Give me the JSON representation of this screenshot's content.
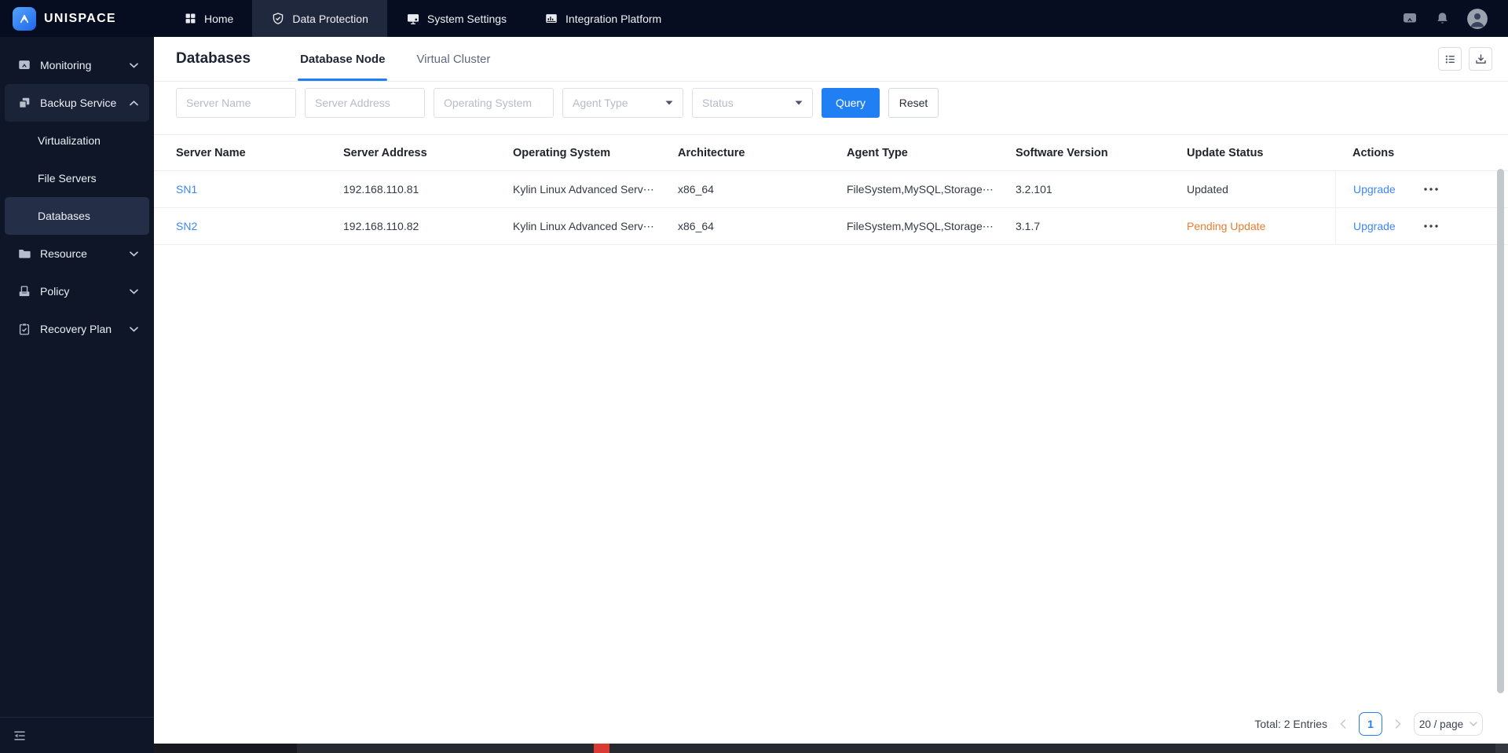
{
  "topbar": {
    "brand": "UNISPACE",
    "nav": [
      {
        "label": "Home",
        "icon": "home-icon",
        "active": false
      },
      {
        "label": "Data Protection",
        "icon": "shield-icon",
        "active": true
      },
      {
        "label": "System Settings",
        "icon": "display-icon",
        "active": false
      },
      {
        "label": "Integration Platform",
        "icon": "chart-window-icon",
        "active": false
      }
    ],
    "right_icons": [
      "message-icon",
      "bell-icon",
      "avatar"
    ]
  },
  "sidebar": {
    "items": [
      {
        "label": "Monitoring",
        "icon": "monitoring-icon",
        "state": "collapsed"
      },
      {
        "label": "Backup Service",
        "icon": "backup-icon",
        "state": "expanded",
        "children": [
          {
            "label": "Virtualization",
            "selected": false
          },
          {
            "label": "File Servers",
            "selected": false
          },
          {
            "label": "Databases",
            "selected": true
          }
        ]
      },
      {
        "label": "Resource",
        "icon": "folder-icon",
        "state": "collapsed"
      },
      {
        "label": "Policy",
        "icon": "policy-icon",
        "state": "collapsed"
      },
      {
        "label": "Recovery Plan",
        "icon": "clipboard-check-icon",
        "state": "collapsed"
      }
    ],
    "footer_icon": "collapse-sidebar-icon"
  },
  "page": {
    "title": "Databases",
    "tabs": [
      {
        "label": "Database Node",
        "active": true
      },
      {
        "label": "Virtual Cluster",
        "active": false
      }
    ],
    "toolbar_icons": [
      "list-icon",
      "download-icon"
    ],
    "filters": {
      "inputs": [
        {
          "placeholder": "Server Name",
          "value": ""
        },
        {
          "placeholder": "Server Address",
          "value": ""
        },
        {
          "placeholder": "Operating System",
          "value": ""
        }
      ],
      "selects": [
        {
          "placeholder": "Agent Type"
        },
        {
          "placeholder": "Status"
        }
      ],
      "query_label": "Query",
      "reset_label": "Reset"
    },
    "table": {
      "columns": [
        "Server Name",
        "Server Address",
        "Operating System",
        "Architecture",
        "Agent Type",
        "Software Version",
        "Update Status",
        "Actions"
      ],
      "rows": [
        {
          "server_name": "SN1",
          "server_address": "192.168.110.81",
          "operating_system": "Kylin Linux Advanced Serv⋯",
          "architecture": "x86_64",
          "agent_type": "FileSystem,MySQL,Storage⋯",
          "software_version": "3.2.101",
          "update_status": "Updated",
          "update_status_state": "updated",
          "action_upgrade": "Upgrade"
        },
        {
          "server_name": "SN2",
          "server_address": "192.168.110.82",
          "operating_system": "Kylin Linux Advanced Serv⋯",
          "architecture": "x86_64",
          "agent_type": "FileSystem,MySQL,Storage⋯",
          "software_version": "3.1.7",
          "update_status": "Pending Update",
          "update_status_state": "pending",
          "action_upgrade": "Upgrade"
        }
      ]
    },
    "pagination": {
      "total_label": "Total: 2 Entries",
      "current_page": "1",
      "page_size_label": "20 / page"
    }
  },
  "colors": {
    "accent": "#2080F3",
    "link": "#3D87F5",
    "pending_update": "#ED7B2F",
    "topbar_bg": "#070D21",
    "sidebar_bg": "#0E1627",
    "sidebar_selected_bg": "#242E47",
    "tab_underline": "#2080F3"
  }
}
